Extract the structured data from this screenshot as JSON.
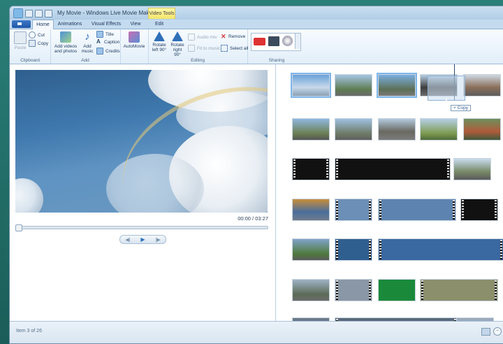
{
  "window": {
    "title": "My Movie - Windows Live Movie Maker",
    "context_tab": "Video Tools"
  },
  "tabs": [
    {
      "label": "Home",
      "active": true
    },
    {
      "label": "Animations",
      "active": false
    },
    {
      "label": "Visual Effects",
      "active": false
    },
    {
      "label": "View",
      "active": false
    },
    {
      "label": "Edit",
      "active": false
    }
  ],
  "ribbon": {
    "clipboard": {
      "label": "Clipboard",
      "paste": "Paste",
      "cut": "Cut",
      "copy": "Copy"
    },
    "add": {
      "label": "Add",
      "add_videos": "Add videos and photos",
      "add_music": "Add music",
      "title": "Title",
      "caption": "Caption",
      "credits": "Credits"
    },
    "automovie": {
      "label": "AutoMovie"
    },
    "editing": {
      "label": "Editing",
      "rotate_left": "Rotate left 90°",
      "rotate_right": "Rotate right 90°",
      "audio_mix": "Audio mix",
      "fit_to_music": "Fit to music",
      "remove": "Remove",
      "select_all": "Select all"
    },
    "sharing": {
      "label": "Sharing"
    }
  },
  "preview": {
    "time": "00:00 / 03:27"
  },
  "drag": {
    "tooltip": "Copy"
  },
  "status": {
    "text": "Item 3 of 26"
  },
  "colors": {
    "accent": "#1f56a6",
    "selection": "#7db6ea",
    "context_tab": "#f3e56a"
  }
}
